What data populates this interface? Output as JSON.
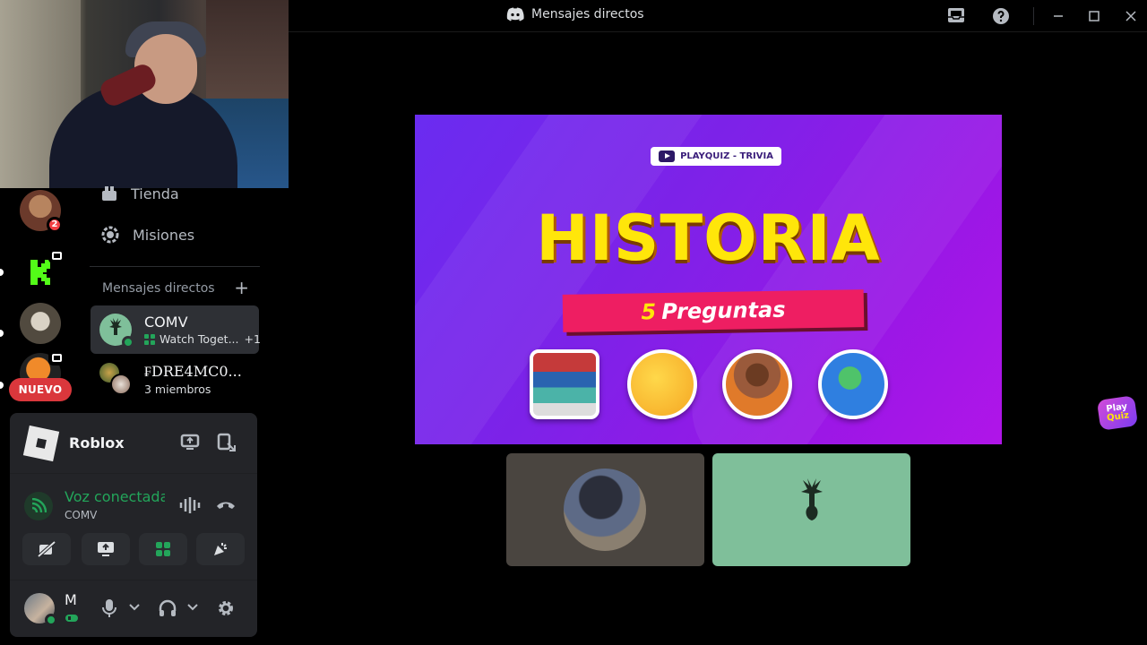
{
  "window": {
    "title": "Mensajes directos"
  },
  "nav": {
    "store": "Tienda",
    "quests": "Misiones"
  },
  "servers": {
    "first_badge": "2",
    "new_label": "NUEVO"
  },
  "dms": {
    "header": "Mensajes directos",
    "add": "+",
    "items": [
      {
        "name": "COMV",
        "status": "Watch Toget...",
        "extra": "+1"
      },
      {
        "name": "₣DRE4MC0...",
        "status": "3 miembros"
      }
    ]
  },
  "activity": {
    "game": "Roblox"
  },
  "voice": {
    "status": "Voz conectada",
    "channel": "COMV"
  },
  "user": {
    "name": "M"
  },
  "stream": {
    "tag": "PLAYQUIZ - TRIVIA",
    "title": "HISTORIA",
    "count": "5",
    "subtitle": "Preguntas"
  },
  "logo": {
    "line1": "Play",
    "line2": "Quiz"
  },
  "colors": {
    "accent_green": "#23a55a",
    "badge_red": "#f23f43",
    "stream_purple": "#7d22e8",
    "headline_yellow": "#ffe60a",
    "tile_green": "#7fbf9a"
  }
}
